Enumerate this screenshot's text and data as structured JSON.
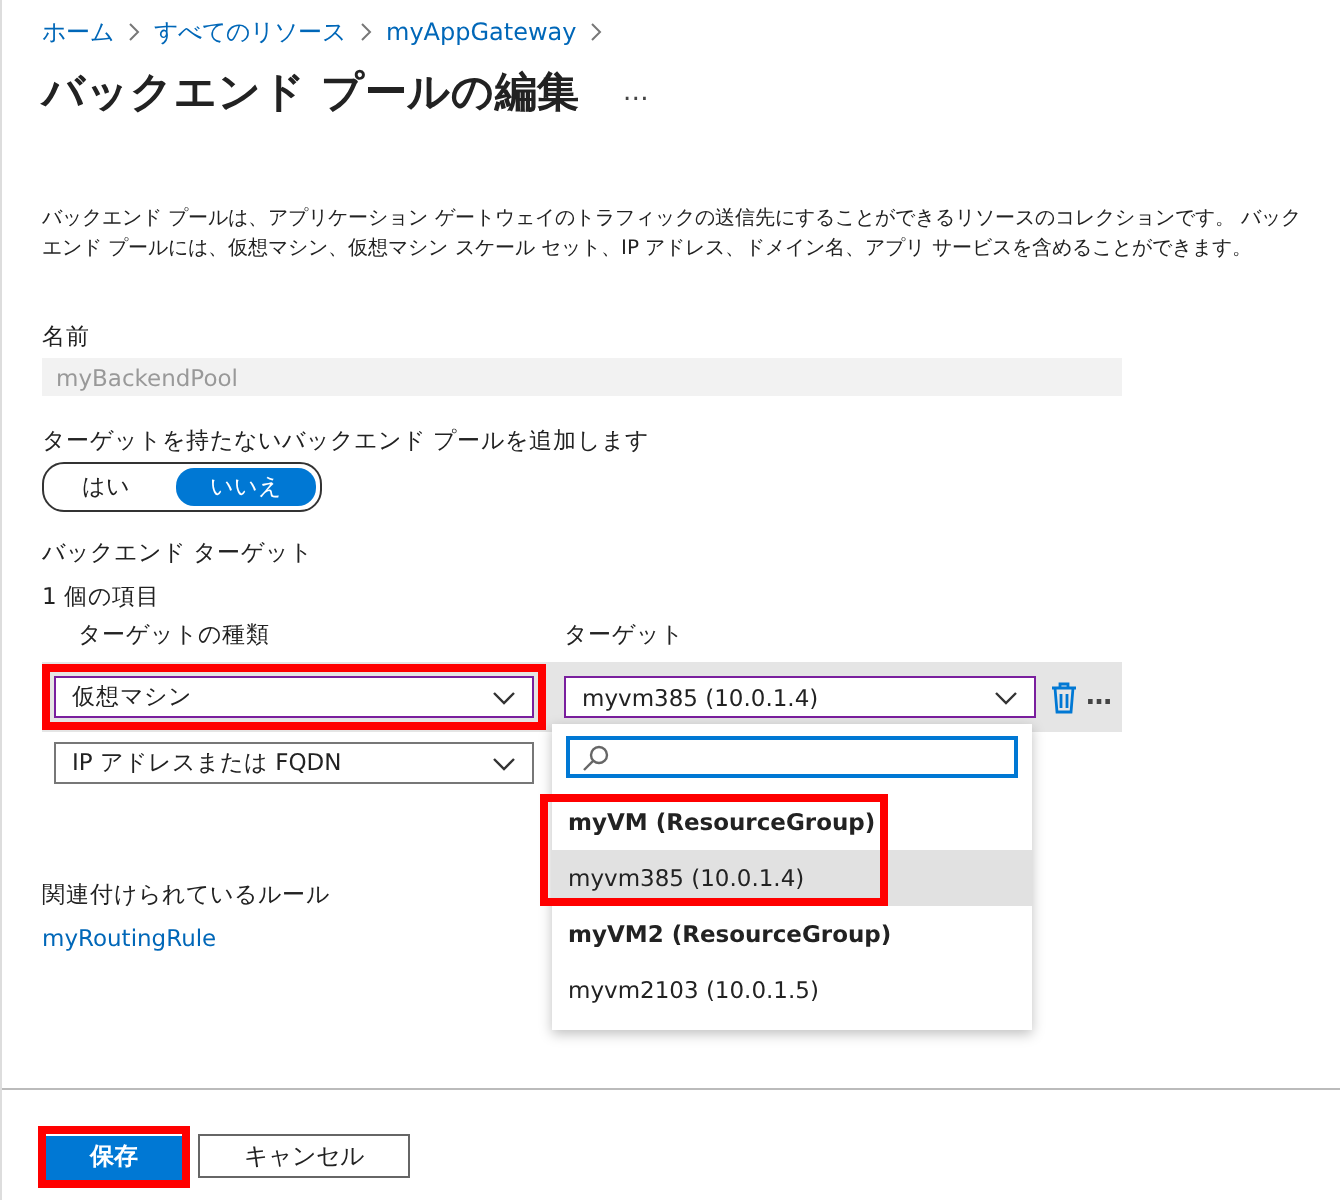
{
  "breadcrumb": [
    {
      "label": "ホーム"
    },
    {
      "label": "すべてのリソース"
    },
    {
      "label": "myAppGateway"
    }
  ],
  "title": "バックエンド プールの編集",
  "more": "…",
  "description": "バックエンド プールは、アプリケーション ゲートウェイのトラフィックの送信先にすることができるリソースのコレクションです。 バックエンド プールには、仮想マシン、仮想マシン スケール セット、IP アドレス、ドメイン名、アプリ サービスを含めることができます。",
  "name_field": {
    "label": "名前",
    "value": "myBackendPool",
    "disabled": true
  },
  "no_target_toggle": {
    "label": "ターゲットを持たないバックエンド プールを追加します",
    "options": [
      {
        "label": "はい",
        "selected": false
      },
      {
        "label": "いいえ",
        "selected": true
      }
    ]
  },
  "backend_targets": {
    "heading": "バックエンド ターゲット",
    "count": "1 個の項目",
    "columns": [
      "ターゲットの種類",
      "ターゲット"
    ],
    "rows": [
      {
        "type": "仮想マシン",
        "type_highlighted": true,
        "target": "myvm385 (10.0.1.4)",
        "more": "…",
        "active": true
      },
      {
        "type": "IP アドレスまたは FQDN",
        "active": false
      }
    ]
  },
  "dropdown": {
    "groups": [
      {
        "label": "myVM (ResourceGroup)",
        "highlighted": true,
        "options": [
          {
            "label": "myvm385 (10.0.1.4)",
            "selected": true
          }
        ]
      },
      {
        "label": "myVM2 (ResourceGroup)",
        "highlighted": false,
        "options": [
          {
            "label": "myvm2103 (10.0.1.5)",
            "selected": false
          }
        ]
      }
    ]
  },
  "rules": {
    "label": "関連付けられているルール",
    "link": "myRoutingRule"
  },
  "buttons": [
    {
      "label": "保存",
      "kind": "primary",
      "highlighted": true
    },
    {
      "label": "キャンセル",
      "kind": "secondary",
      "highlighted": false
    }
  ]
}
